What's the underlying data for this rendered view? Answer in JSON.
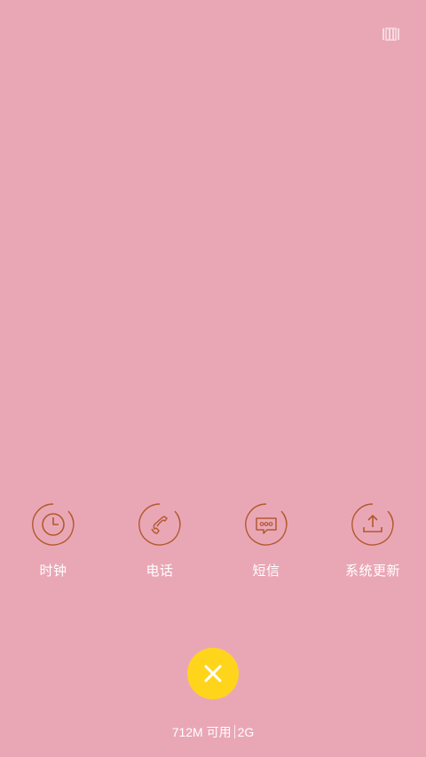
{
  "top_bar": {
    "view_toggle_icon": "list-view-icon"
  },
  "apps": [
    {
      "label": "时钟",
      "icon": "clock-icon"
    },
    {
      "label": "电话",
      "icon": "phone-icon"
    },
    {
      "label": "短信",
      "icon": "message-icon"
    },
    {
      "label": "系统更新",
      "icon": "upload-icon"
    }
  ],
  "close_button": {
    "icon": "close-icon",
    "color": "#ffd51c"
  },
  "memory": {
    "available": "712M 可用",
    "total": "2G"
  },
  "colors": {
    "background": "#e9a7b6",
    "icon_stroke": "#b2592e"
  }
}
